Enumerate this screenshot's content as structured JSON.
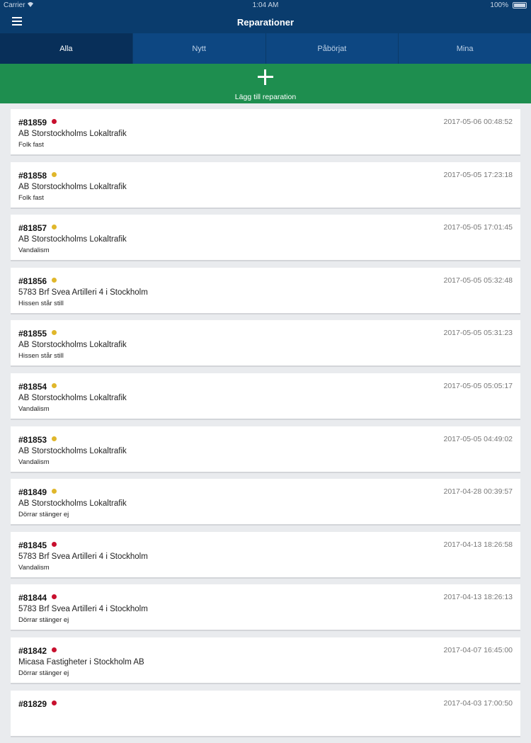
{
  "statusbar": {
    "carrier": "Carrier",
    "time": "1:04 AM",
    "battery": "100%"
  },
  "header": {
    "title": "Reparationer"
  },
  "tabs": [
    {
      "label": "Alla",
      "active": true
    },
    {
      "label": "Nytt",
      "active": false
    },
    {
      "label": "Påbörjat",
      "active": false
    },
    {
      "label": "Mina",
      "active": false
    }
  ],
  "add_button": {
    "label": "Lägg till reparation"
  },
  "colors": {
    "red": "#c8102e",
    "yellow": "#e0b72b"
  },
  "repairs": [
    {
      "id": "#81859",
      "status": "red",
      "company": "AB Storstockholms Lokaltrafik",
      "description": "Folk fast",
      "date": "2017-05-06 00:48:52"
    },
    {
      "id": "#81858",
      "status": "yellow",
      "company": "AB Storstockholms Lokaltrafik",
      "description": "Folk fast",
      "date": "2017-05-05 17:23:18"
    },
    {
      "id": "#81857",
      "status": "yellow",
      "company": "AB Storstockholms Lokaltrafik",
      "description": "Vandalism",
      "date": "2017-05-05 17:01:45"
    },
    {
      "id": "#81856",
      "status": "yellow",
      "company": "5783 Brf Svea Artilleri 4 i Stockholm",
      "description": "Hissen står still",
      "date": "2017-05-05 05:32:48"
    },
    {
      "id": "#81855",
      "status": "yellow",
      "company": "AB Storstockholms Lokaltrafik",
      "description": "Hissen står still",
      "date": "2017-05-05 05:31:23"
    },
    {
      "id": "#81854",
      "status": "yellow",
      "company": "AB Storstockholms Lokaltrafik",
      "description": "Vandalism",
      "date": "2017-05-05 05:05:17"
    },
    {
      "id": "#81853",
      "status": "yellow",
      "company": "AB Storstockholms Lokaltrafik",
      "description": "Vandalism",
      "date": "2017-05-05 04:49:02"
    },
    {
      "id": "#81849",
      "status": "yellow",
      "company": "AB Storstockholms Lokaltrafik",
      "description": "Dörrar stänger ej",
      "date": "2017-04-28 00:39:57"
    },
    {
      "id": "#81845",
      "status": "red",
      "company": "5783 Brf Svea Artilleri 4 i Stockholm",
      "description": "Vandalism",
      "date": "2017-04-13 18:26:58"
    },
    {
      "id": "#81844",
      "status": "red",
      "company": "5783 Brf Svea Artilleri 4 i Stockholm",
      "description": "Dörrar stänger ej",
      "date": "2017-04-13 18:26:13"
    },
    {
      "id": "#81842",
      "status": "red",
      "company": "Micasa Fastigheter i Stockholm AB",
      "description": "Dörrar stänger ej",
      "date": "2017-04-07 16:45:00"
    },
    {
      "id": "#81829",
      "status": "red",
      "company": "",
      "description": "",
      "date": "2017-04-03 17:00:50"
    }
  ]
}
